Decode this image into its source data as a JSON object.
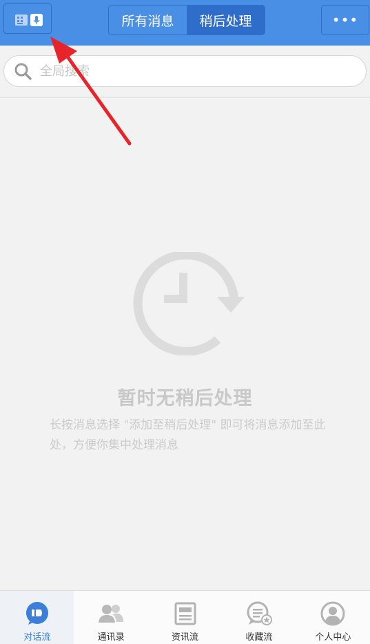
{
  "header": {
    "tabs": [
      {
        "label": "所有消息",
        "active": false
      },
      {
        "label": "稍后处理",
        "active": true
      }
    ],
    "more_label": "•••",
    "mode_toggle_icons": [
      "keyboard-icon",
      "microphone-icon"
    ]
  },
  "search": {
    "placeholder": "全局搜索"
  },
  "empty_state": {
    "icon": "clock-later-icon",
    "title": "暂时无稍后处理",
    "description": "长按消息选择 \"添加至稍后处理\" 即可将消息添加至此处，方便你集中处理消息"
  },
  "bottom_nav": {
    "items": [
      {
        "label": "对话流",
        "icon": "chat-flow-icon",
        "active": true
      },
      {
        "label": "通讯录",
        "icon": "contacts-icon",
        "active": false
      },
      {
        "label": "资讯流",
        "icon": "news-icon",
        "active": false
      },
      {
        "label": "收藏流",
        "icon": "favorites-icon",
        "active": false
      },
      {
        "label": "个人中心",
        "icon": "profile-icon",
        "active": false
      }
    ]
  },
  "colors": {
    "header_bg": "#4a8fe6",
    "active_tab_bg": "#2e6dc9",
    "accent": "#3b7fd8",
    "annotation_arrow": "#e8242b"
  }
}
